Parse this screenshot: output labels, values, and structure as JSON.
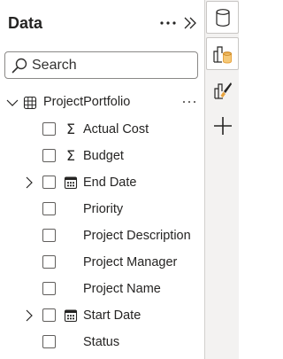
{
  "panel": {
    "title": "Data",
    "more_icon": "more-icon",
    "collapse_icon": "double-chevron-right-icon"
  },
  "search": {
    "placeholder": "Search",
    "icon": "search-icon"
  },
  "table": {
    "name": "ProjectPortfolio",
    "icon": "table-icon",
    "expanded": true
  },
  "fields": [
    {
      "label": "Actual Cost",
      "icon": "sigma-icon",
      "expandable": false,
      "checked": false
    },
    {
      "label": "Budget",
      "icon": "sigma-icon",
      "expandable": false,
      "checked": false
    },
    {
      "label": "End Date",
      "icon": "calendar-icon",
      "expandable": true,
      "checked": false
    },
    {
      "label": "Priority",
      "icon": "",
      "expandable": false,
      "checked": false
    },
    {
      "label": "Project Description",
      "icon": "",
      "expandable": false,
      "checked": false
    },
    {
      "label": "Project Manager",
      "icon": "",
      "expandable": false,
      "checked": false
    },
    {
      "label": "Project Name",
      "icon": "",
      "expandable": false,
      "checked": false
    },
    {
      "label": "Start Date",
      "icon": "calendar-icon",
      "expandable": true,
      "checked": false
    },
    {
      "label": "Status",
      "icon": "",
      "expandable": false,
      "checked": false
    }
  ],
  "rail": {
    "buttons": [
      {
        "icon": "database-icon",
        "selected": true
      },
      {
        "icon": "build-visual-icon",
        "selected": true
      },
      {
        "icon": "format-visual-icon",
        "selected": false
      },
      {
        "icon": "add-icon",
        "selected": false
      }
    ]
  },
  "colors": {
    "accent_orange": "#e8a33d",
    "text": "#252423",
    "rail_background": "#f3f2f1"
  }
}
